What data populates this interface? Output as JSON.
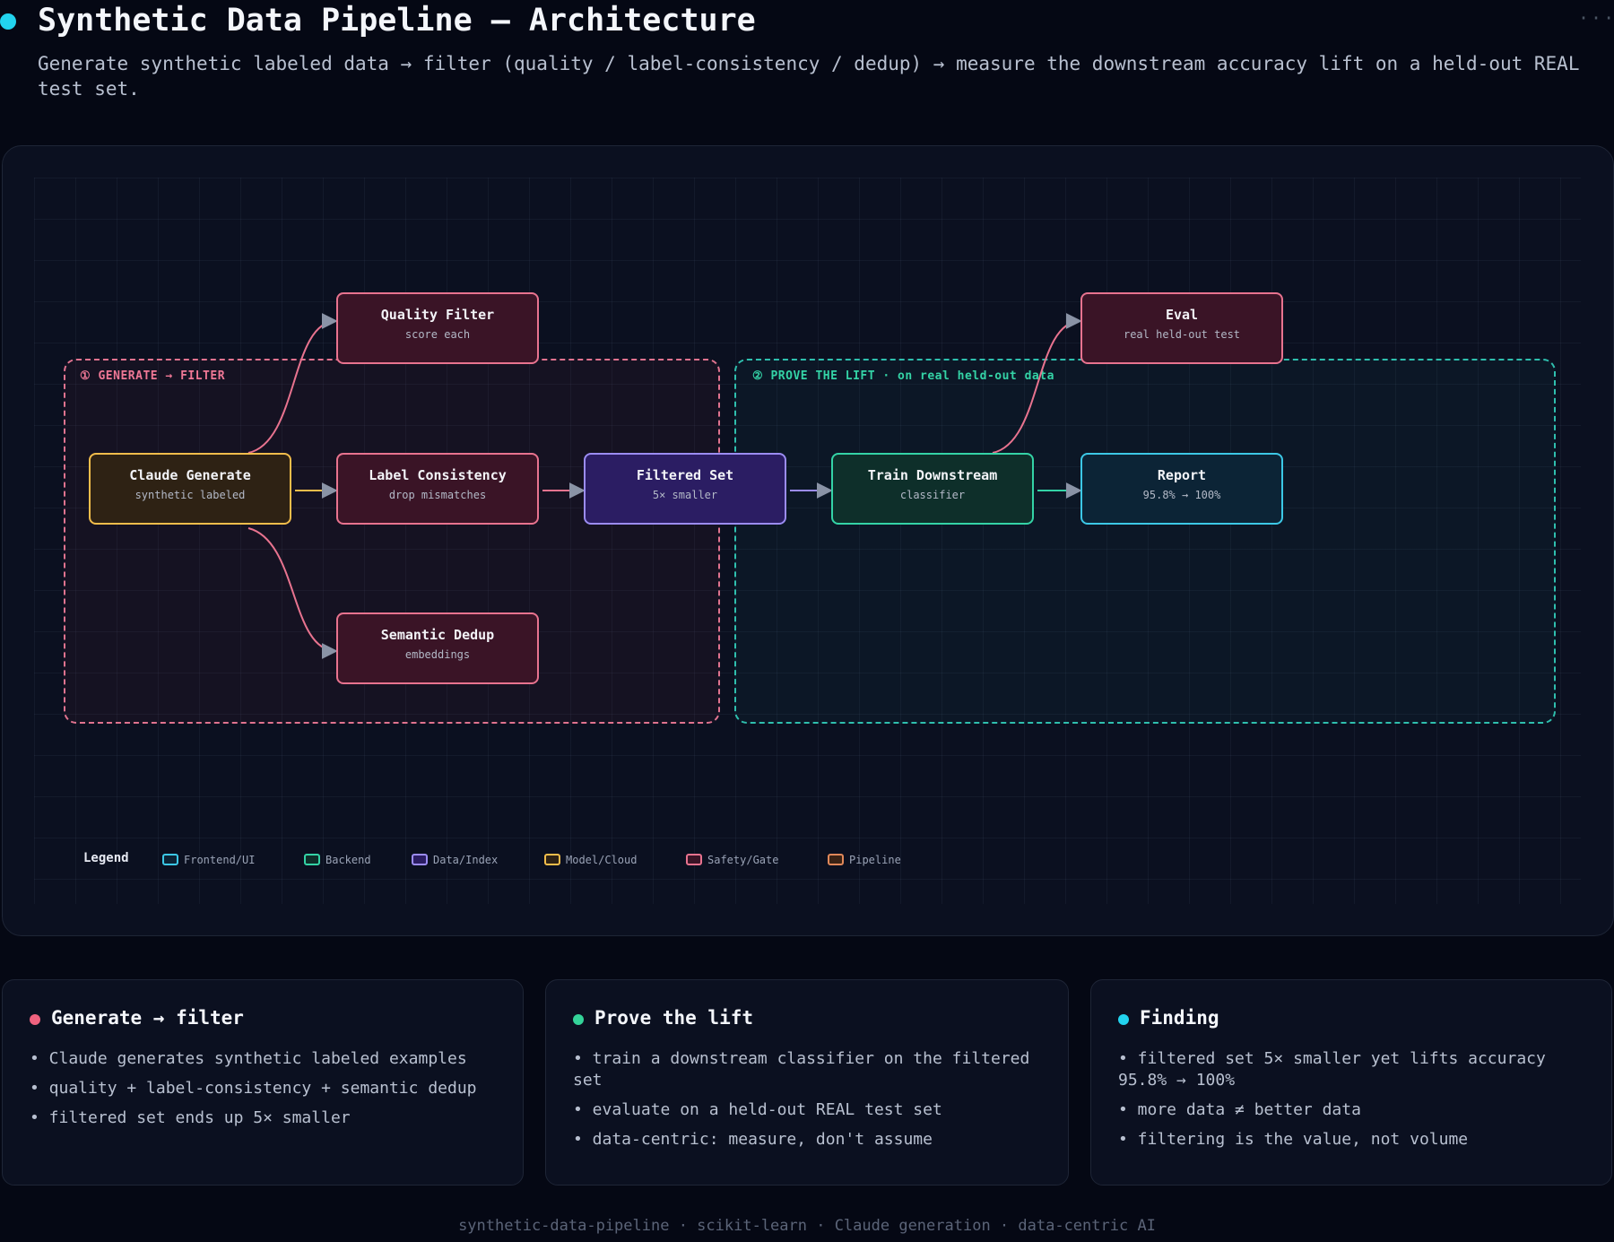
{
  "header": {
    "title": "Synthetic Data Pipeline — Architecture",
    "subtitle": "Generate synthetic labeled data → filter (quality / label-consistency / dedup) → measure the downstream accuracy lift on a held-out REAL test set.",
    "more_icon": "ellipsis-icon",
    "more_label": "···"
  },
  "groups": {
    "generate_filter": "① GENERATE → FILTER",
    "prove_lift": "② PROVE THE LIFT · on real held-out data"
  },
  "nodes": {
    "claude_generate": {
      "title": "Claude Generate",
      "sub": "synthetic labeled"
    },
    "quality_filter": {
      "title": "Quality Filter",
      "sub": "score each"
    },
    "label_consistency": {
      "title": "Label Consistency",
      "sub": "drop mismatches"
    },
    "semantic_dedup": {
      "title": "Semantic Dedup",
      "sub": "embeddings"
    },
    "filtered_set": {
      "title": "Filtered Set",
      "sub": "5× smaller"
    },
    "train_downstream": {
      "title": "Train Downstream",
      "sub": "classifier"
    },
    "eval": {
      "title": "Eval",
      "sub": "real held-out test"
    },
    "report": {
      "title": "Report",
      "sub": "95.8% → 100%"
    }
  },
  "legend": {
    "title": "Legend",
    "items": [
      {
        "label": "Frontend/UI",
        "color": "#3cc8e6"
      },
      {
        "label": "Backend",
        "color": "#34d3a6"
      },
      {
        "label": "Data/Index",
        "color": "#9b8cf2"
      },
      {
        "label": "Model/Cloud",
        "color": "#f2bd4b"
      },
      {
        "label": "Safety/Gate",
        "color": "#e8738f"
      },
      {
        "label": "Pipeline",
        "color": "#e0885a"
      }
    ]
  },
  "cards": [
    {
      "title": "Generate → filter",
      "dot_color": "#f0627f",
      "items": [
        "• Claude generates synthetic labeled examples",
        "• quality + label-consistency + semantic dedup",
        "• filtered set ends up 5× smaller"
      ]
    },
    {
      "title": "Prove the lift",
      "dot_color": "#34d399",
      "items": [
        "• train a downstream classifier on the filtered set",
        "• evaluate on a held-out REAL test set",
        "• data-centric: measure, don't assume"
      ]
    },
    {
      "title": "Finding",
      "dot_color": "#22d3ee",
      "items": [
        "• filtered set 5× smaller yet lifts accuracy 95.8% → 100%",
        "• more data ≠ better data",
        "• filtering is the value, not volume"
      ]
    }
  ],
  "footer": "synthetic-data-pipeline · scikit-learn · Claude generation · data-centric AI"
}
